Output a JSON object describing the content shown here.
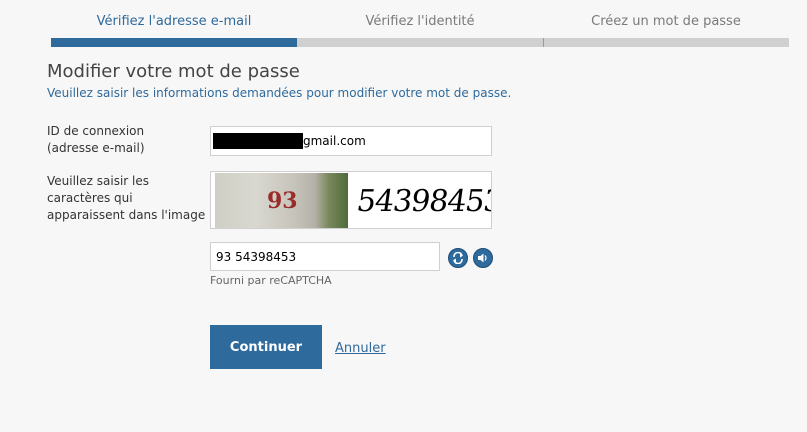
{
  "steps": [
    {
      "label": "Vérifiez l'adresse e-mail",
      "state": "active"
    },
    {
      "label": "Vérifiez l'identité",
      "state": "pending"
    },
    {
      "label": "Créez un mot de passe",
      "state": "pending"
    }
  ],
  "progress": {
    "completed_fraction": 0.33
  },
  "form": {
    "title": "Modifier votre mot de passe",
    "subtitle": "Veuillez saisir les informations demandées pour modifier votre mot de passe.",
    "login_label_line1": "ID de connexion",
    "login_label_line2": "(adresse e-mail)",
    "login_value_visible": "gmail.com",
    "captcha_label_line1": "Veuillez saisir les",
    "captcha_label_line2": "caractères qui",
    "captcha_label_line3": "apparaissent dans l'image",
    "captcha_image_number": "93",
    "captcha_image_text": "54398453",
    "captcha_input_value": "93 54398453",
    "provided_by": "Fourni par reCAPTCHA",
    "continue_label": "Continuer",
    "cancel_label": "Annuler"
  },
  "icons": {
    "refresh": "refresh-icon",
    "audio": "audio-icon"
  },
  "colors": {
    "accent": "#2f6a9c",
    "background": "#f7f7f7",
    "inactive_bar": "#d0d0d0"
  }
}
